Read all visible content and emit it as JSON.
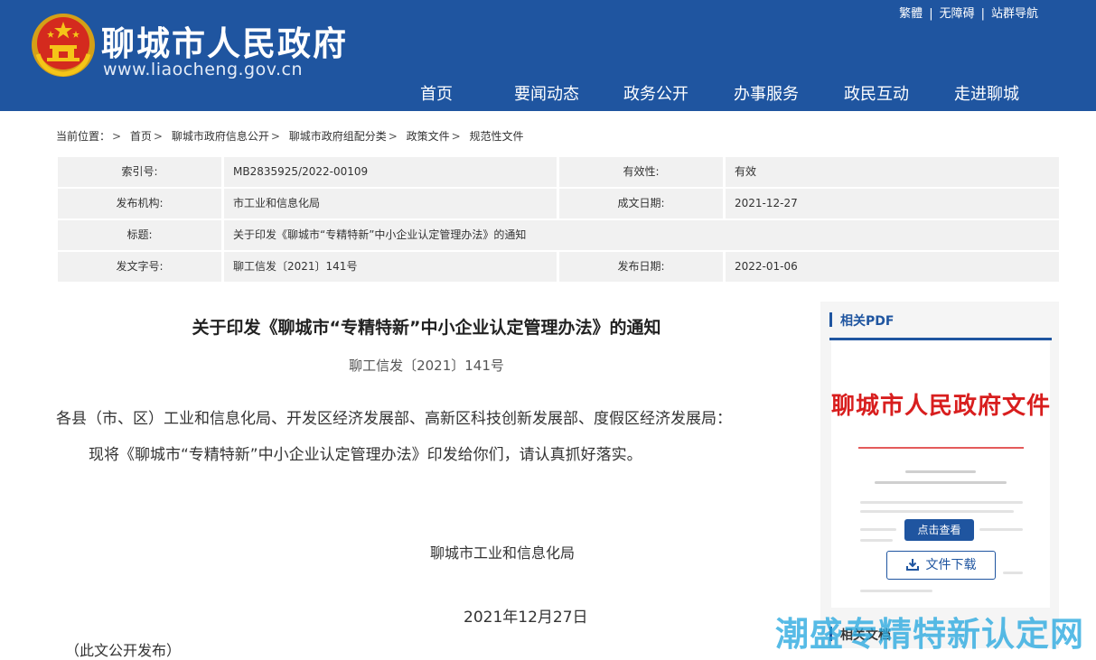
{
  "header": {
    "site_name": "聊城市人民政府",
    "site_url": "www.liaocheng.gov.cn",
    "bg_color": "#1f55a0",
    "top_links": [
      "繁體",
      "无障碍",
      "站群导航"
    ],
    "nav": [
      "首页",
      "要闻动态",
      "政务公开",
      "办事服务",
      "政民互动",
      "走进聊城"
    ]
  },
  "breadcrumb": {
    "prefix": "当前位置：",
    "items": [
      "首页",
      "聊城市政府信息公开",
      "聊城市政府组配分类",
      "政策文件",
      "规范性文件"
    ]
  },
  "meta": {
    "index_label": "索引号:",
    "index_value": "MB2835925/2022-00109",
    "validity_label": "有效性:",
    "validity_value": "有效",
    "issuer_label": "发布机构:",
    "issuer_value": "市工业和信息化局",
    "written_date_label": "成文日期:",
    "written_date_value": "2021-12-27",
    "title_label": "标题:",
    "title_value": "关于印发《聊城市“专精特新”中小企业认定管理办法》的通知",
    "doc_no_label": "发文字号:",
    "doc_no_value": "聊工信发〔2021〕141号",
    "publish_date_label": "发布日期:",
    "publish_date_value": "2022-01-06"
  },
  "article": {
    "title": "关于印发《聊城市“专精特新”中小企业认定管理办法》的通知",
    "doc_no": "聊工信发〔2021〕141号",
    "salutation": "各县（市、区）工业和信息化局、开发区经济发展部、高新区科技创新发展部、度假区经济发展局：",
    "body": "现将《聊城市“专精特新”中小企业认定管理办法》印发给你们，请认真抓好落实。",
    "signature_org": "聊城市工业和信息化局",
    "signature_date": "2021年12月27日",
    "note": "（此文公开发布）"
  },
  "sidebar": {
    "pdf_heading": "相关PDF",
    "pdf_preview_title": "聊城市人民政府文件",
    "view_button": "点击查看",
    "download_button": "文件下载",
    "docs_heading": "相关文档"
  },
  "watermark": "潮盛专精特新认定网",
  "icons": {
    "emblem": "national-emblem-icon",
    "download": "download-icon"
  }
}
